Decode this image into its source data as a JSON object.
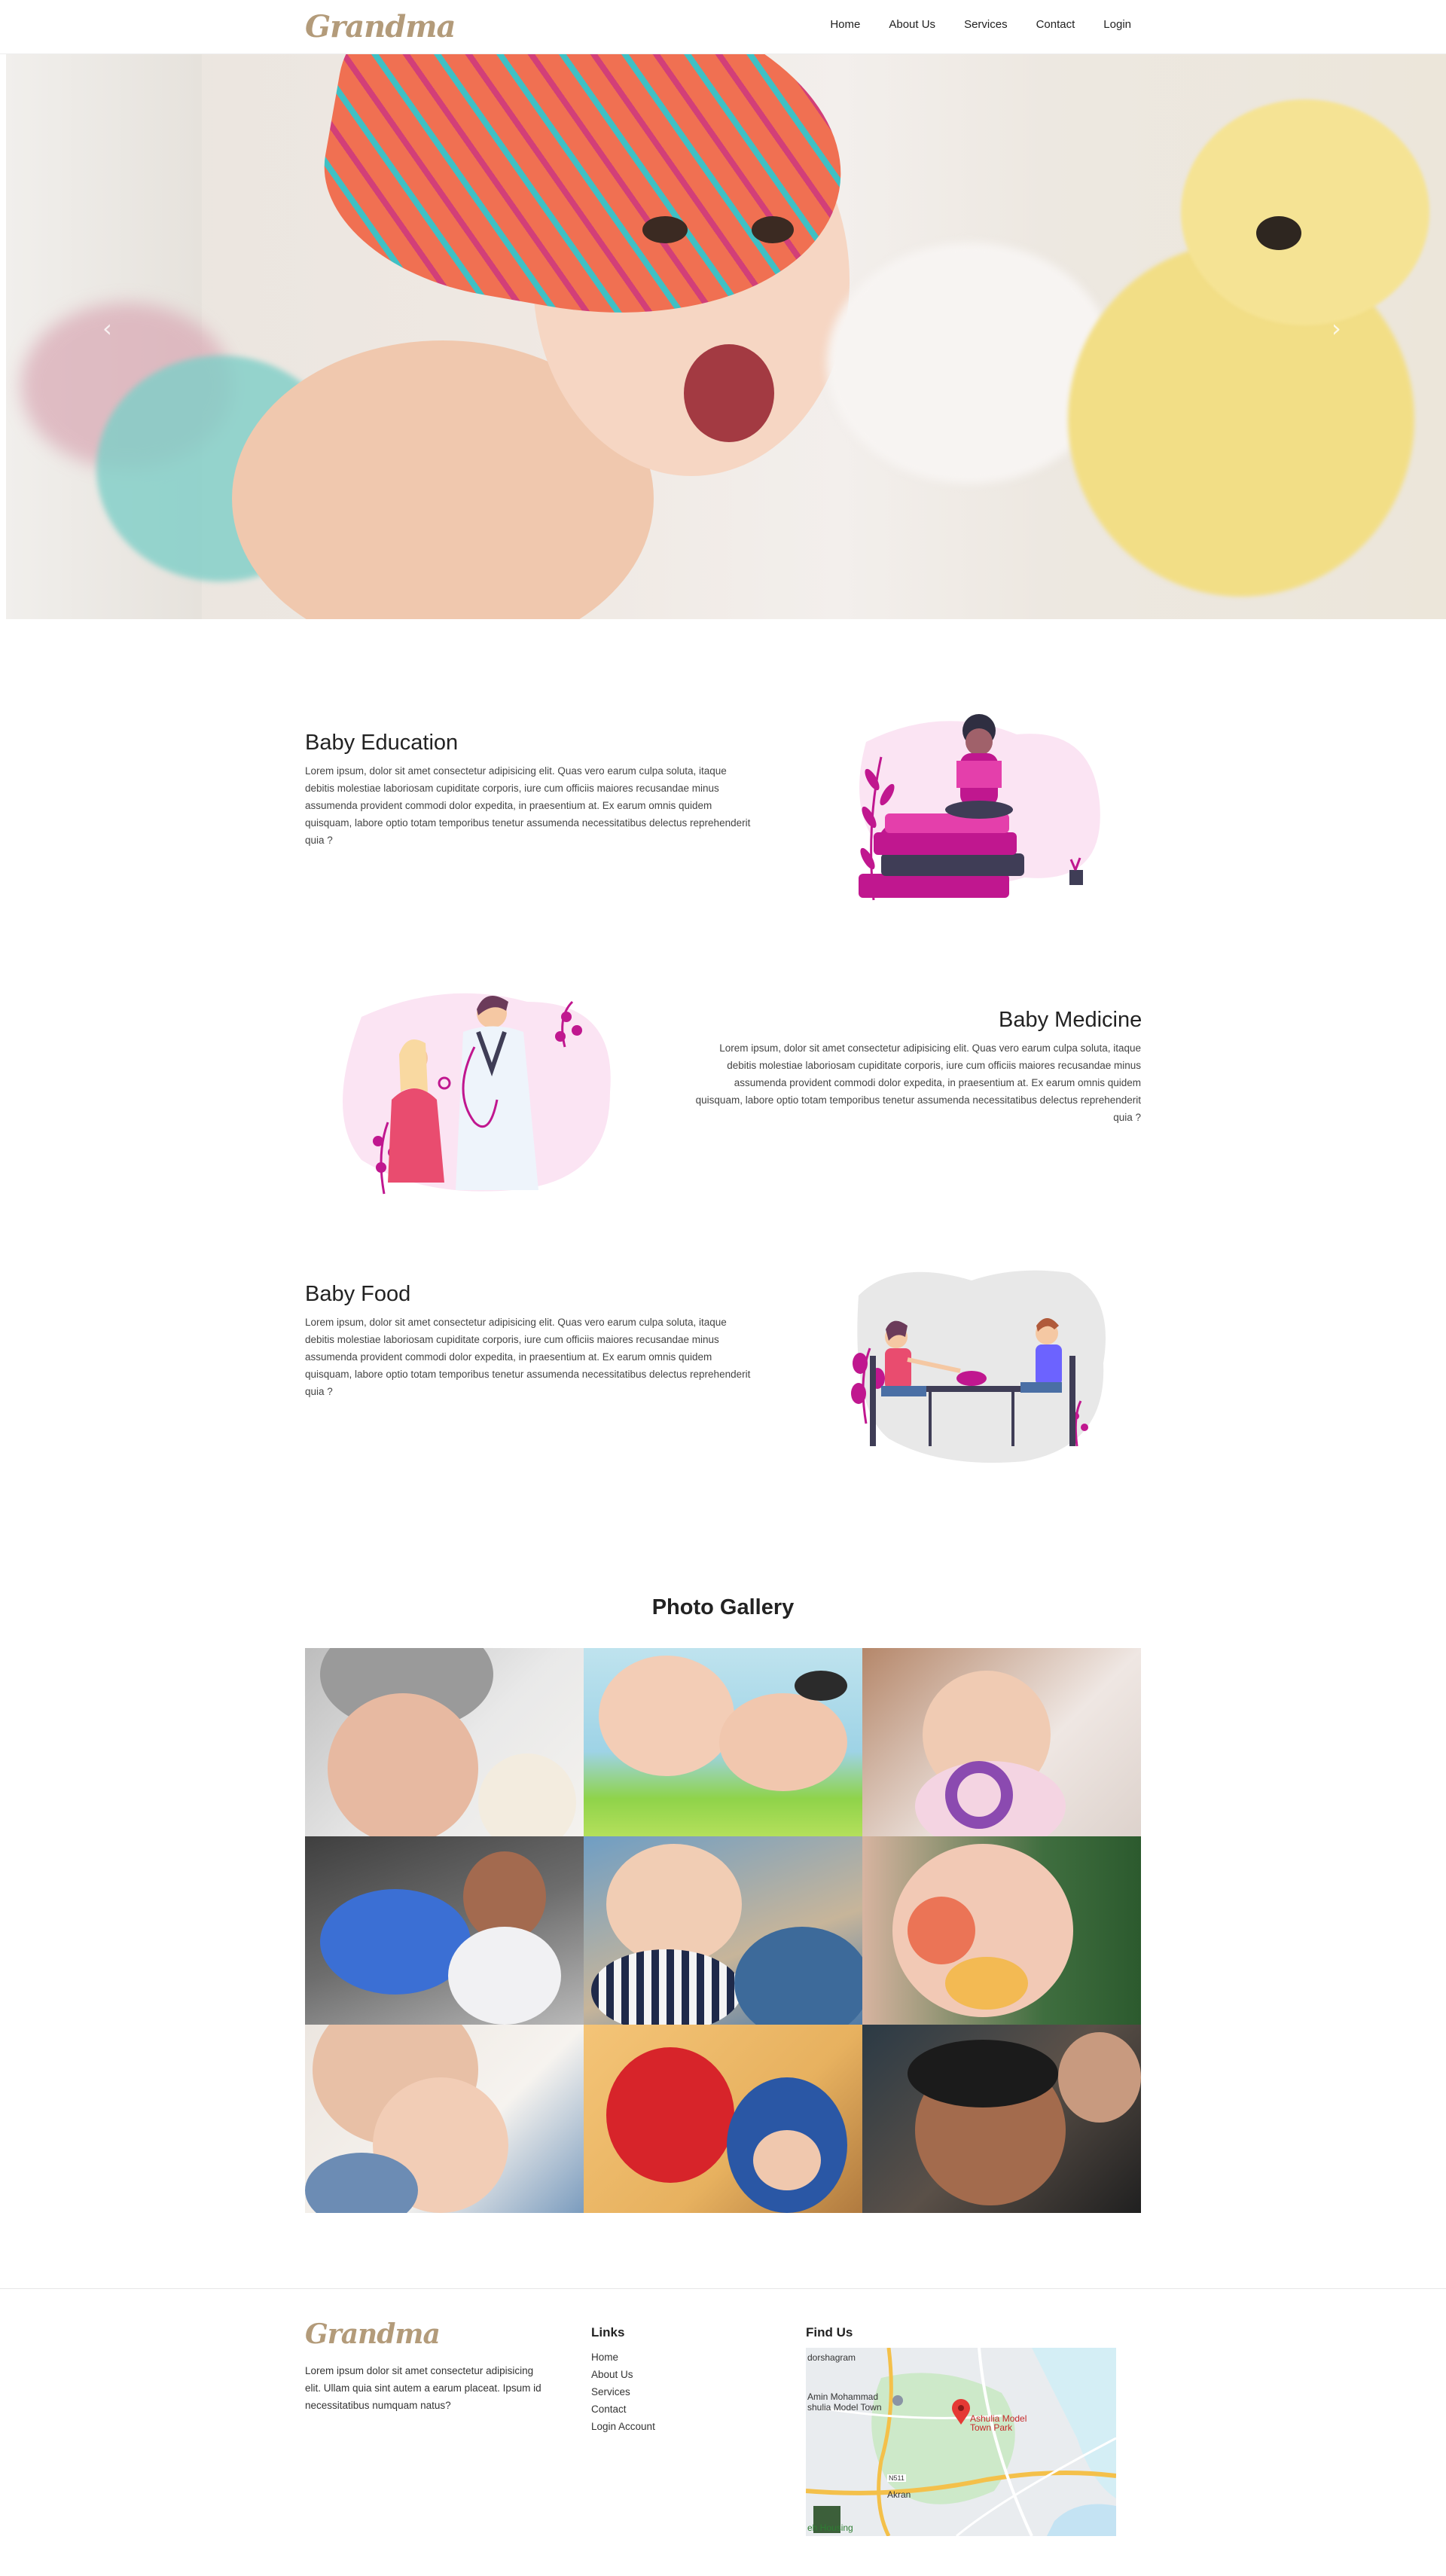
{
  "brand": {
    "logo_text": "Grandma"
  },
  "nav": {
    "items": [
      "Home",
      "About Us",
      "Services",
      "Contact",
      "Login"
    ]
  },
  "hero": {
    "prev_icon": "chevron-left-icon",
    "next_icon": "chevron-right-icon",
    "prev_glyph": "‹",
    "next_glyph": "›"
  },
  "features": [
    {
      "title": "Baby Education",
      "text": "Lorem ipsum, dolor sit amet consectetur adipisicing elit. Quas vero earum culpa soluta, itaque debitis molestiae laboriosam cupiditate corporis, iure cum officiis maiores recusandae minus assumenda provident commodi dolor expedita, in praesentium at. Ex earum omnis quidem quisquam, labore optio totam temporibus tenetur assumenda necessitatibus delectus reprehenderit quia ?"
    },
    {
      "title": "Baby Medicine",
      "text": "Lorem ipsum, dolor sit amet consectetur adipisicing elit. Quas vero earum culpa soluta, itaque debitis molestiae laboriosam cupiditate corporis, iure cum officiis maiores recusandae minus assumenda provident commodi dolor expedita, in praesentium at. Ex earum omnis quidem quisquam, labore optio totam temporibus tenetur assumenda necessitatibus delectus reprehenderit quia ?"
    },
    {
      "title": "Baby Food",
      "text": "Lorem ipsum, dolor sit amet consectetur adipisicing elit. Quas vero earum culpa soluta, itaque debitis molestiae laboriosam cupiditate corporis, iure cum officiis maiores recusandae minus assumenda provident commodi dolor expedita, in praesentium at. Ex earum omnis quidem quisquam, labore optio totam temporibus tenetur assumenda necessitatibus delectus reprehenderit quia ?"
    }
  ],
  "gallery": {
    "title": "Photo Gallery"
  },
  "footer": {
    "logo_text": "Grandma",
    "about": "Lorem ipsum dolor sit amet consectetur adipisicing elit. Ullam quia sint autem a earum placeat. Ipsum id necessitatibus numquam natus?",
    "links_heading": "Links",
    "links": [
      "Home",
      "About Us",
      "Services",
      "Contact",
      "Login Account"
    ],
    "find_heading": "Find Us",
    "map_labels": {
      "top": "dorshagram",
      "poi_name": "Amin Mohammad\nshulia Model Town",
      "park": "Ashulia Model\nTown Park",
      "road_tag": "N511",
      "town": "Akran",
      "bottom": "eh Housing"
    }
  },
  "colors": {
    "accent": "#c0178f",
    "brand": "#b39b7a",
    "text": "#222222"
  }
}
